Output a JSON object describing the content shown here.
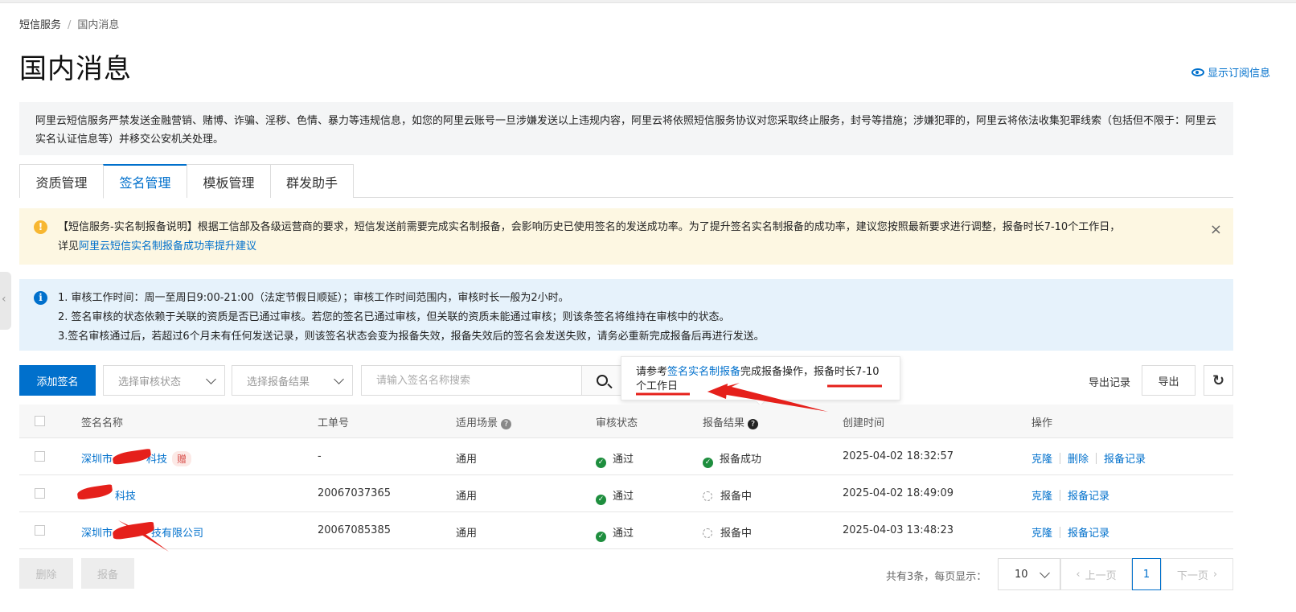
{
  "breadcrumb": {
    "root": "短信服务",
    "separator": "/",
    "current": "国内消息"
  },
  "page": {
    "title": "国内消息",
    "subscribe_link": "显示订阅信息"
  },
  "notice": "阿里云短信服务严禁发送金融营销、赌博、诈骗、淫秽、色情、暴力等违规信息，如您的阿里云账号一旦涉嫌发送以上违规内容，阿里云将依照短信服务协议对您采取终止服务，封号等措施；涉嫌犯罪的，阿里云将依法收集犯罪线索（包括但不限于：阿里云实名认证信息等）并移交公安机关处理。",
  "tabs": [
    {
      "label": "资质管理"
    },
    {
      "label": "签名管理"
    },
    {
      "label": "模板管理"
    },
    {
      "label": "群发助手"
    }
  ],
  "warning": {
    "text": "【短信服务-实名制报备说明】根据工信部及各级运营商的要求，短信发送前需要完成实名制报备，会影响历史已使用签名的发送成功率。为了提升签名实名制报备的成功率，建议您按照最新要求进行调整，报备时长7-10个工作日，",
    "prefix2": "详见",
    "link": "阿里云短信实名制报备成功率提升建议",
    "close": "×"
  },
  "info": {
    "lines": [
      "1. 审核工作时间：周一至周日9:00-21:00（法定节假日顺延）；审核工作时间范围内，审核时长一般为2小时。",
      "2. 签名审核的状态依赖于关联的资质是否已通过审核。若您的签名已通过审核，但关联的资质未能通过审核；则该条签名将维持在审核中的状态。",
      "3.签名审核通过后，若超过6个月未有任何发送记录，则该签名状态会变为报备失效，报备失效后的签名会发送失败，请务必重新完成报备后再进行发送。"
    ]
  },
  "toolbar": {
    "add_label": "添加签名",
    "audit_select": "选择审核状态",
    "report_select": "选择报备结果",
    "search_placeholder": "请输入签名名称搜索",
    "export_records": "导出记录",
    "export": "导出"
  },
  "tooltip": {
    "prefix": "请参考",
    "link": "签名实名制报备",
    "middle": "完成报备操作，",
    "tail": "报备时长7-10个工作日"
  },
  "table": {
    "headers": {
      "name": "签名名称",
      "ticket": "工单号",
      "scene": "适用场景",
      "audit": "审核状态",
      "report": "报备结果",
      "created": "创建时间",
      "ops": "操作"
    },
    "rows": [
      {
        "name_prefix": "深圳市",
        "name_suffix": "科技",
        "gift": "赠",
        "ticket": "-",
        "scene": "通用",
        "audit": "通过",
        "report": "报备成功",
        "report_state": "success",
        "created": "2025-04-02 18:32:57",
        "ops": [
          "克隆",
          "删除",
          "报备记录"
        ]
      },
      {
        "name_prefix": "",
        "name_suffix": "科技",
        "gift": "",
        "ticket": "20067037365",
        "scene": "通用",
        "audit": "通过",
        "report": "报备中",
        "report_state": "pending",
        "created": "2025-04-02 18:49:09",
        "ops": [
          "克隆",
          "报备记录"
        ]
      },
      {
        "name_prefix": "深圳市",
        "name_suffix": "技有限公司",
        "gift": "",
        "ticket": "20067085385",
        "scene": "通用",
        "audit": "通过",
        "report": "报备中",
        "report_state": "pending",
        "created": "2025-04-03 13:48:23",
        "ops": [
          "克隆",
          "报备记录"
        ]
      }
    ]
  },
  "bulk": {
    "delete": "删除",
    "report": "报备"
  },
  "pagination": {
    "summary": "共有3条，每页显示：",
    "page_size": "10",
    "prev": "上一页",
    "current": "1",
    "next": "下一页"
  },
  "colors": {
    "accent": "#0070cc",
    "success": "#1e8e3e",
    "warning_bg": "#fdf7e2",
    "info_bg": "#e6f2fb",
    "annotation": "#e5201b"
  }
}
